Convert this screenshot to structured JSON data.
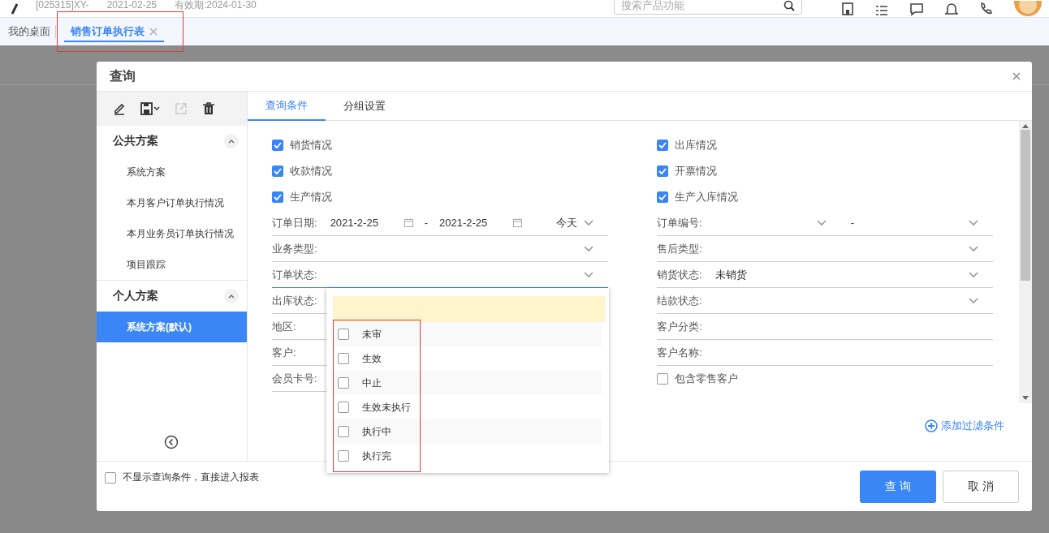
{
  "header": {
    "account": "[025315]XY-",
    "date": "2021-02-25",
    "expiry": "有效期:2024-01-30",
    "search_placeholder": "搜索产品功能"
  },
  "tabs": [
    {
      "label": "我的桌面",
      "selected": false,
      "closable": false
    },
    {
      "label": "销售订单执行表",
      "selected": true,
      "closable": true
    }
  ],
  "dialog": {
    "title": "查询",
    "sidebar": {
      "sections": [
        {
          "title": "公共方案",
          "expanded": true,
          "items": [
            {
              "label": "系统方案",
              "selected": false
            },
            {
              "label": "本月客户订单执行情况",
              "selected": false
            },
            {
              "label": "本月业务员订单执行情况",
              "selected": false
            },
            {
              "label": "项目跟踪",
              "selected": false
            }
          ]
        },
        {
          "title": "个人方案",
          "expanded": true,
          "items": [
            {
              "label": "系统方案(默认)",
              "selected": true
            }
          ]
        }
      ]
    },
    "query_tabs": [
      {
        "label": "查询条件",
        "selected": true
      },
      {
        "label": "分组设置",
        "selected": false
      }
    ],
    "form_left": [
      {
        "kind": "checkbox",
        "label": "销货情况",
        "checked": true
      },
      {
        "kind": "checkbox",
        "label": "收款情况",
        "checked": true
      },
      {
        "kind": "checkbox",
        "label": "生产情况",
        "checked": true
      },
      {
        "kind": "date_range",
        "label": "订单日期:",
        "from": "2021-2-25",
        "separator": "-",
        "to": "2021-2-25",
        "preset": "今天",
        "focused": false
      },
      {
        "kind": "select",
        "label": "业务类型:",
        "focused": false
      },
      {
        "kind": "select",
        "label": "订单状态:",
        "focused": true
      },
      {
        "kind": "text",
        "label": "出库状态:",
        "focused": false
      },
      {
        "kind": "text",
        "label": "地区:",
        "focused": false
      },
      {
        "kind": "text",
        "label": "客户:",
        "focused": false
      },
      {
        "kind": "text",
        "label": "会员卡号:",
        "focused": false
      }
    ],
    "form_right": [
      {
        "kind": "checkbox",
        "label": "出库情况",
        "checked": true
      },
      {
        "kind": "checkbox",
        "label": "开票情况",
        "checked": true
      },
      {
        "kind": "checkbox",
        "label": "生产入库情况",
        "checked": true
      },
      {
        "kind": "select_range",
        "label": "订单编号:",
        "separator": "-",
        "focused": false
      },
      {
        "kind": "select",
        "label": "售后类型:",
        "focused": false
      },
      {
        "kind": "select",
        "label": "销货状态:",
        "value": "未销货",
        "focused": false
      },
      {
        "kind": "select",
        "label": "结款状态:",
        "focused": false
      },
      {
        "kind": "text",
        "label": "客户分类:",
        "focused": false
      },
      {
        "kind": "text",
        "label": "客户名称:",
        "focused": false
      },
      {
        "kind": "checkbox",
        "label": "包含零售客户",
        "checked": false
      }
    ],
    "add_filter": "添加过滤条件",
    "dropdown": {
      "options": [
        {
          "label": "未审",
          "checked": false
        },
        {
          "label": "生效",
          "checked": false
        },
        {
          "label": "中止",
          "checked": false
        },
        {
          "label": "生效未执行",
          "checked": false
        },
        {
          "label": "执行中",
          "checked": false
        },
        {
          "label": "执行完",
          "checked": false
        }
      ]
    },
    "footer": {
      "skip_option": {
        "label": "不显示查询条件，直接进入报表",
        "checked": false
      },
      "buttons": [
        {
          "label": "查 询",
          "kind": "primary"
        },
        {
          "label": "取 消",
          "kind": "default"
        }
      ]
    }
  }
}
